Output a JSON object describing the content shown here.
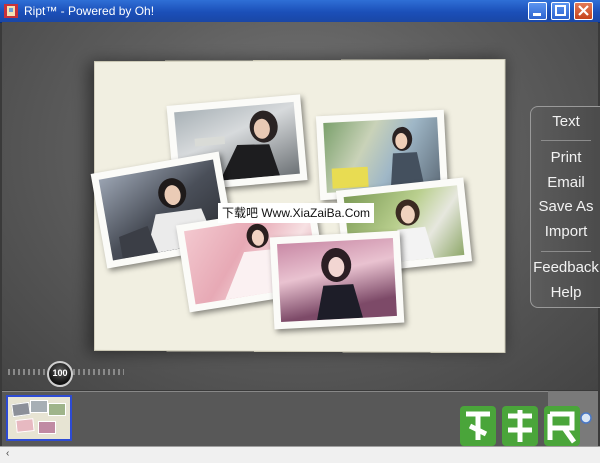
{
  "window": {
    "title": "Ript™ - Powered by Oh!",
    "minimize_glyph": "minimize-icon",
    "maximize_glyph": "maximize-icon",
    "close_glyph": "close-icon"
  },
  "canvas": {
    "watermark": "下载吧 Www.XiaZaiBa.Com",
    "photo_count": 6
  },
  "side_menu": {
    "items": [
      "Text",
      "Print",
      "Email",
      "Save As",
      "Import",
      "Feedback",
      "Help"
    ]
  },
  "zoom": {
    "value": "100",
    "level": 0.45
  },
  "filmstrip": {
    "thumbnails": 1
  },
  "status": {
    "text": "‹"
  },
  "colors": {
    "titlebar": "#1b4fb8",
    "canvas": "#f1efe1",
    "thumb_border": "#2d4bd4",
    "logo_green": "#4aa53a"
  }
}
